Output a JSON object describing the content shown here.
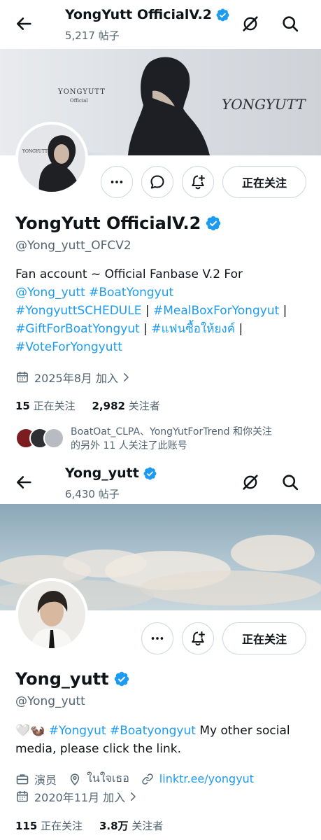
{
  "profile1": {
    "header": {
      "name": "YongYutt OfficialV.2",
      "post_count": "5,217 帖子"
    },
    "banner": {
      "text_left_top": "YONGYUTT",
      "text_left_bottom": "Official",
      "text_right": "YONGYUTT"
    },
    "avatar": {
      "text": "YONGYUTT"
    },
    "follow_label": "正在关注",
    "name": "YongYutt OfficialV.2",
    "handle": "@Yong_yutt_OFCV2",
    "bio": {
      "text1": "Fan account ~ Official Fanbase V.2 For",
      "links": [
        "@Yong_yutt",
        "#BoatYongyut",
        "#YongyuttSCHEDULE",
        "#MealBoxForYongyut",
        "#GiftForBoatYongyut",
        "#แฟนซื้อให้ยงค์",
        "#VoteForYongyutt"
      ],
      "sep": " | "
    },
    "joined": "2025年8月 加入",
    "following_count": "15",
    "following_label": "正在关注",
    "followers_count": "2,982",
    "followers_label": "关注者",
    "followed_by_line1": "BoatOat_CLPA、YongYutForTrend 和你关注",
    "followed_by_line2": "的另外 11 人关注了此账号"
  },
  "profile2": {
    "header": {
      "name": "Yong_yutt",
      "post_count": "6,430 帖子"
    },
    "follow_label": "正在关注",
    "name": "Yong_yutt",
    "handle": "@Yong_yutt",
    "bio": {
      "emoji": "🤍🦦",
      "links": [
        "#Yongyut",
        "#Boatyongyut"
      ],
      "text1": " My other social",
      "text2": "media, please click the link."
    },
    "profession": "演员",
    "location": "ในใจเธอ",
    "website": "linktr.ee/yongyut",
    "joined": "2020年11月 加入",
    "following_count": "115",
    "following_label": "正在关注",
    "followers_count": "3.8万",
    "followers_label": "关注者"
  },
  "colors": {
    "accent": "#1d9bf0",
    "text": "#0f1419",
    "secondary": "#536471",
    "border": "#cfd9de"
  },
  "icons": [
    "back-arrow-icon",
    "verified-badge-icon",
    "grok-icon",
    "search-icon",
    "more-icon",
    "message-icon",
    "notification-bell-plus-icon",
    "calendar-icon",
    "chevron-right-icon",
    "briefcase-icon",
    "location-pin-icon",
    "link-icon"
  ]
}
